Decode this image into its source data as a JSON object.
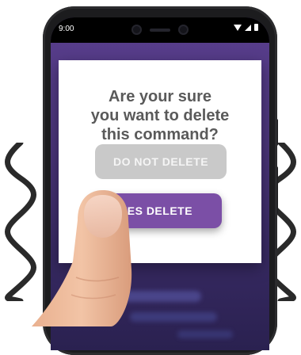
{
  "status_bar": {
    "time": "9:00"
  },
  "dialog": {
    "title_lines": [
      "Are your sure",
      "you want to delete",
      "this command?"
    ],
    "secondary_button": "DO NOT DELETE",
    "primary_button": "YES DELETE"
  },
  "colors": {
    "primary_button": "#7b4fa6",
    "secondary_button": "#c9c9c9",
    "title_text": "#5a5a5a",
    "screen_background": "#4a3479"
  },
  "icons": [
    "wifi-icon",
    "signal-icon",
    "battery-icon",
    "vibration-wave-icon",
    "finger-illustration"
  ]
}
